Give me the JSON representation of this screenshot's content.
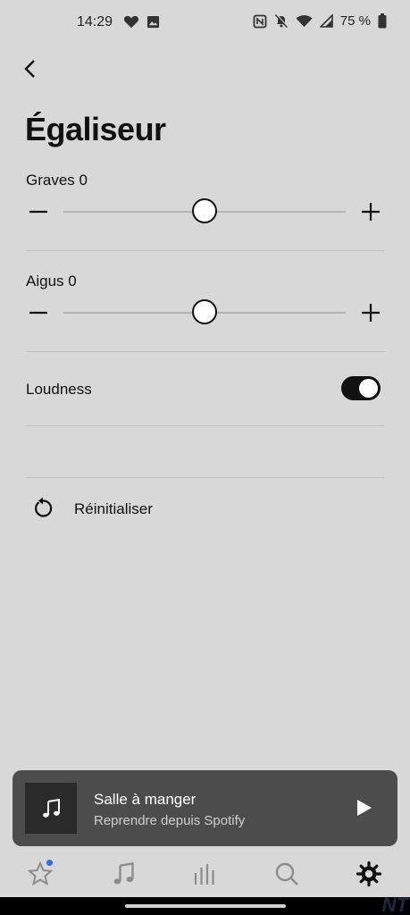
{
  "status_bar": {
    "time": "14:29",
    "battery_percent": "75 %",
    "left_icons": [
      "heart-icon",
      "image-icon"
    ],
    "right_icons": [
      "nfc-icon",
      "bell-muted-icon",
      "wifi-icon",
      "signal-icon",
      "battery-icon"
    ]
  },
  "header": {
    "back_icon": "chevron-left-icon",
    "title": "Égaliseur"
  },
  "bass": {
    "label": "Graves 0",
    "value": 0,
    "min": -10,
    "max": 10
  },
  "treble": {
    "label": "Aigus 0",
    "value": 0,
    "min": -10,
    "max": 10
  },
  "loudness": {
    "label": "Loudness",
    "enabled": true
  },
  "reset": {
    "label": "Réinitialiser",
    "icon": "reset-icon"
  },
  "mini_player": {
    "title": "Salle à manger",
    "subtitle": "Reprendre depuis Spotify",
    "art_icon": "music-note-icon",
    "play_icon": "play-icon"
  },
  "nav": {
    "items": [
      {
        "name": "favorites",
        "icon": "star-icon",
        "active": false,
        "badge": true
      },
      {
        "name": "music",
        "icon": "music-note-icon",
        "active": false,
        "badge": false
      },
      {
        "name": "rooms",
        "icon": "bars-icon",
        "active": false,
        "badge": false
      },
      {
        "name": "search",
        "icon": "search-icon",
        "active": false,
        "badge": false
      },
      {
        "name": "settings",
        "icon": "gear-icon",
        "active": true,
        "badge": false
      }
    ]
  },
  "watermark": "NT",
  "colors": {
    "background": "#d8d8d8",
    "player_bg": "#4c4c4c",
    "badge": "#2f6fe4",
    "inactive_nav": "#8c8c8c",
    "active_nav": "#111111"
  }
}
